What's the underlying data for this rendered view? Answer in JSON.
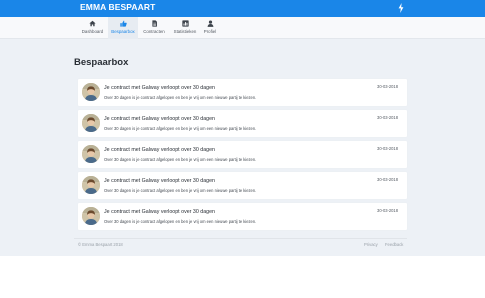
{
  "app": {
    "brand": "EMMA BESPAART",
    "accent_color": "#1a86e8",
    "top_icon": "bolt-icon"
  },
  "nav": {
    "items": [
      {
        "label": "Dashboard",
        "icon": "home-icon",
        "active": false
      },
      {
        "label": "Bespaarbox",
        "icon": "thumbs-up-icon",
        "active": true
      },
      {
        "label": "Contracten",
        "icon": "document-icon",
        "active": false
      },
      {
        "label": "Statistieken",
        "icon": "chart-icon",
        "active": false
      },
      {
        "label": "Profiel",
        "icon": "user-icon",
        "active": false
      }
    ]
  },
  "main": {
    "title": "Bespaarbox",
    "messages": [
      {
        "title": "Je contract met Galway verloopt over 30 dagen",
        "text": "Over 30 dagen is je contract afgelopen en ben je vrij om een nieuwe partij te kiezen.",
        "date": "30-03-2018"
      },
      {
        "title": "Je contract met Galway verloopt over 30 dagen",
        "text": "Over 30 dagen is je contract afgelopen en ben je vrij om een nieuwe partij te kiezen.",
        "date": "30-03-2018"
      },
      {
        "title": "Je contract met Galway verloopt over 30 dagen",
        "text": "Over 30 dagen is je contract afgelopen en ben je vrij om een nieuwe partij te kiezen.",
        "date": "30-03-2018"
      },
      {
        "title": "Je contract met Galway verloopt over 30 dagen",
        "text": "Over 30 dagen is je contract afgelopen en ben je vrij om een nieuwe partij te kiezen.",
        "date": "30-03-2018"
      },
      {
        "title": "Je contract met Galway verloopt over 30 dagen",
        "text": "Over 30 dagen is je contract afgelopen en ben je vrij om een nieuwe partij te kiezen.",
        "date": "30-03-2018"
      }
    ]
  },
  "footer": {
    "copyright": "© Emma Bespaart 2018",
    "privacy": "Privacy",
    "feedback": "Feedback"
  }
}
